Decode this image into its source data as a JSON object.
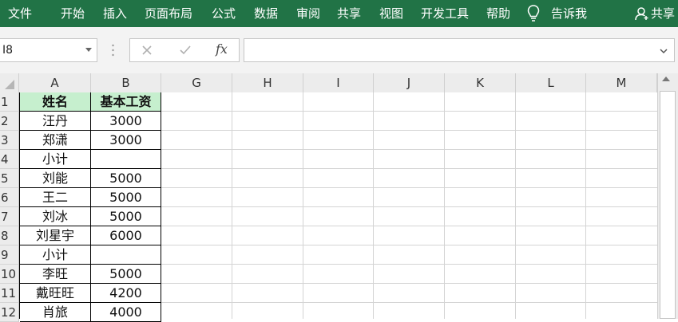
{
  "ribbon": {
    "tabs": [
      "文件",
      "开始",
      "插入",
      "页面布局",
      "公式",
      "数据",
      "审阅",
      "共享",
      "视图",
      "开发工具",
      "帮助"
    ],
    "tell_me": "告诉我",
    "share": "共享",
    "bg_color": "#217346"
  },
  "formula_bar": {
    "name_box": "I8",
    "fx_label": "fx",
    "formula": ""
  },
  "grid": {
    "columns": [
      "A",
      "B",
      "G",
      "H",
      "I",
      "J",
      "K",
      "L",
      "M"
    ],
    "rows": [
      "1",
      "2",
      "3",
      "4",
      "5",
      "6",
      "7",
      "8",
      "9",
      "10",
      "11",
      "12"
    ],
    "header_fill": "#c6efce",
    "table": [
      [
        "姓名",
        "基本工资"
      ],
      [
        "汪丹",
        "3000"
      ],
      [
        "郑潇",
        "3000"
      ],
      [
        "小计",
        ""
      ],
      [
        "刘能",
        "5000"
      ],
      [
        "王二",
        "5000"
      ],
      [
        "刘冰",
        "5000"
      ],
      [
        "刘星宇",
        "6000"
      ],
      [
        "小计",
        ""
      ],
      [
        "李旺",
        "5000"
      ],
      [
        "戴旺旺",
        "4200"
      ],
      [
        "肖旅",
        "4000"
      ]
    ]
  }
}
